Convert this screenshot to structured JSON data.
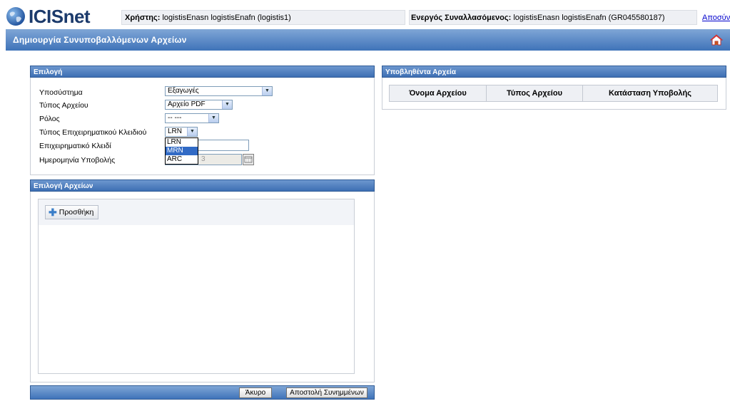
{
  "header": {
    "logo_text": "ICISnet",
    "user_label": "Χρήστης:",
    "user_value": "logistisEnasn logistisEnafn (logistis1)",
    "party_label": "Ενεργός Συναλλασόμενος:",
    "party_value": "logistisEnasn logistisEnafn (GR045580187)",
    "logout_link": "Αποσύνδ"
  },
  "page": {
    "title": "Δημιουργία Συνυποβαλλόμενων Αρχείων"
  },
  "selection_panel": {
    "title": "Επιλογή",
    "fields": [
      {
        "label": "Υποσύστημα",
        "value": "Εξαγωγές"
      },
      {
        "label": "Τύπος Αρχείου",
        "value": "Αρχείο PDF"
      },
      {
        "label": "Ρόλος",
        "value": "-- ---"
      },
      {
        "label": "Τύπος Επιχειρηματικού Κλειδιού",
        "value": "LRN"
      },
      {
        "label": "Επιχειρηματικό Κλειδί",
        "value": ""
      },
      {
        "label": "Ημερομηνία Υποβολής",
        "value": "3"
      }
    ],
    "key_type_options": [
      "LRN",
      "MRN",
      "ARC"
    ],
    "key_type_highlighted": "MRN"
  },
  "files_panel": {
    "title": "Επιλογή Αρχείων",
    "add_button": "Προσθήκη"
  },
  "actions": {
    "cancel": "Άκυρο",
    "send": "Αποστολή Συνημμένων"
  },
  "uploaded_panel": {
    "title": "Υποβληθέντα Αρχεία",
    "columns": [
      "Όνομα Αρχείου",
      "Τύπος Αρχείου",
      "Κατάσταση Υποβολής"
    ]
  },
  "colors": {
    "header_blue": "#3f73b9",
    "highlight": "#316ac5"
  }
}
